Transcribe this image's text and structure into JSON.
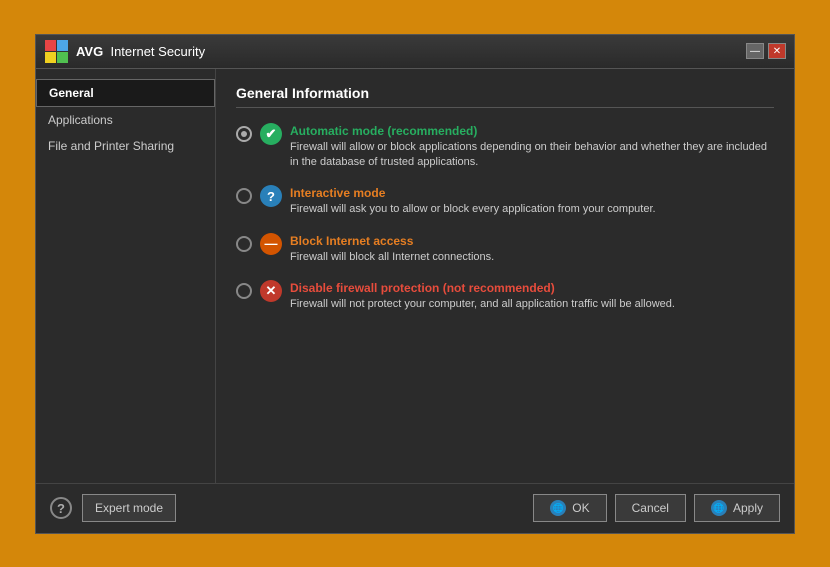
{
  "window": {
    "title": "Internet Security",
    "brand": "AVG",
    "controls": {
      "minimize": "—",
      "close": "✕"
    }
  },
  "sidebar": {
    "items": [
      {
        "id": "general",
        "label": "General",
        "active": true
      },
      {
        "id": "applications",
        "label": "Applications",
        "active": false
      },
      {
        "id": "file-printer",
        "label": "File and Printer Sharing",
        "active": false
      }
    ]
  },
  "main": {
    "section_title": "General Information",
    "options": [
      {
        "id": "automatic",
        "selected": true,
        "icon": "✔",
        "icon_style": "green",
        "label": "Automatic mode (recommended)",
        "label_color": "green",
        "description": "Firewall will allow or block applications depending on their behavior and whether they are included in the database of trusted applications."
      },
      {
        "id": "interactive",
        "selected": false,
        "icon": "?",
        "icon_style": "blue",
        "label": "Interactive mode",
        "label_color": "orange",
        "description": "Firewall will ask you to allow or block every application from your computer."
      },
      {
        "id": "block",
        "selected": false,
        "icon": "—",
        "icon_style": "orange",
        "label": "Block Internet access",
        "label_color": "orange",
        "description": "Firewall will block all Internet connections."
      },
      {
        "id": "disable",
        "selected": false,
        "icon": "✕",
        "icon_style": "red",
        "label": "Disable firewall protection (not recommended)",
        "label_color": "red",
        "description": "Firewall will not protect your computer, and all application traffic will be allowed."
      }
    ]
  },
  "footer": {
    "help_label": "?",
    "expert_mode_label": "Expert mode",
    "ok_label": "OK",
    "cancel_label": "Cancel",
    "apply_label": "Apply"
  }
}
